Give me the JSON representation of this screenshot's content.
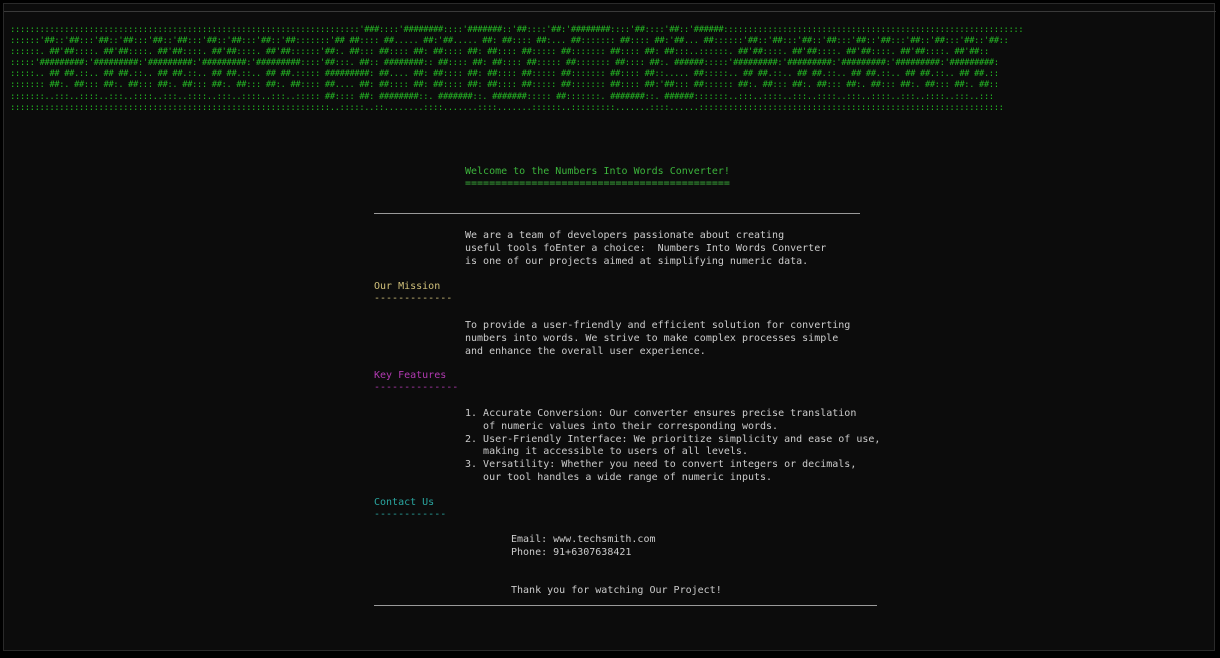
{
  "banner_lines": [
    ":::::::::::::::::::::::::::::::::::::::::::::::::::::::::::::::::::::::'###::::'########::::'#######::'##::::'##:'########::::'##::::'##::'######:::::::::::::::::::::::::::::::::::::::::::::::::::::::::::::",
    "::::::'##::'##:::'##::'##:::'##::'##:::'##::'##:::'##::'##:::::::'## ##:::: ##..... ##:'##..... ##: ##:::: ##:... ##::::::: ##:::: ##:'##... ##::::::'##::'##:::'##::'##:::'##::'##:::'##::'##:::'##::'##::",
    "::::::. ##'##::::. ##'##::::. ##'##::::. ##'##::::. ##'##::::::'##:. ##::: ##:::: ##: ##:::: ##: ##:::: ##::::: ##::::::: ##:::: ##: ##:::..::::::. ##'##::::. ##'##::::. ##'##::::. ##'##::::. ##'##::",
    ":::::'#########:'#########:'#########:'#########:'#########::::'##:::. ##:: ########:: ##:::: ##: ##:::: ##::::: ##::::::: ##:::: ##:. ######:::::'#########:'#########:'#########:'#########:'#########:",
    ":::::.. ## ##.::.. ## ##.::.. ## ##.::.. ## ##.::.. ## ##.::::: #########: ##.... ##: ##:::: ##: ##:::: ##::::: ##::::::: ##:::: ##::..... ##:::::.. ## ##.::.. ## ##.::.. ## ##.::.. ## ##.::.. ## ##.::",
    "::::::: ##:. ##::: ##:. ##::: ##:. ##::: ##:. ##::: ##:. ##:::: ##.... ##: ##:::: ##: ##:::: ##: ##:::: ##::::: ##::::::: ##:::: ##:'##::: ##:::::: ##:. ##::: ##:. ##::: ##:. ##::: ##:. ##::: ##:. ##::",
    ":::::::..:::..::::..:::..::::..:::..::::..:::..::::..:::..::::: ##:::: ##: ########::. #######::. #######::::: ##:::::::. #######::. ######:::::::..:::..::::..:::..::::..:::..::::..:::..::::..:::..:::",
    ":::::::::::::::::::::::::::::::::::::::::::::::::::::::::::::::::..:::::..::........::::.......::::.......::::::..:::::::::.......::::......::::::::::::::::::::::::::::::::::::::::::::::::::::::::::::::"
  ],
  "welcome_title": "Welcome to the Numbers Into Words Converter!",
  "welcome_underline": "============================================",
  "intro_lines": [
    "We are a team of developers passionate about creating",
    "useful tools foEnter a choice:  Numbers Into Words Converter",
    "is one of our projects aimed at simplifying numeric data."
  ],
  "mission_heading": "Our Mission",
  "mission_underline": "-------------",
  "mission_lines": [
    "To provide a user-friendly and efficient solution for converting",
    "numbers into words. We strive to make complex processes simple",
    "and enhance the overall user experience."
  ],
  "features_heading": "Key Features",
  "features_underline": "--------------",
  "features_lines": [
    "1. Accurate Conversion: Our converter ensures precise translation",
    "   of numeric values into their corresponding words.",
    "2. User-Friendly Interface: We prioritize simplicity and ease of use,",
    "   making it accessible to users of all levels.",
    "3. Versatility: Whether you need to convert integers or decimals,",
    "   our tool handles a wide range of numeric inputs."
  ],
  "contact_heading": "Contact Us",
  "contact_underline": "------------",
  "email_line": "Email: www.techsmith.com",
  "phone_line": "Phone: 91+6307638421",
  "thanks_line": "Thank you for watching Our Project!",
  "colors": {
    "banner": "#24b824",
    "welcome": "#3cb43c",
    "mission": "#d0c07a",
    "features": "#b23ab2",
    "contact": "#2aa6a0",
    "body_text": "#cccccc"
  }
}
